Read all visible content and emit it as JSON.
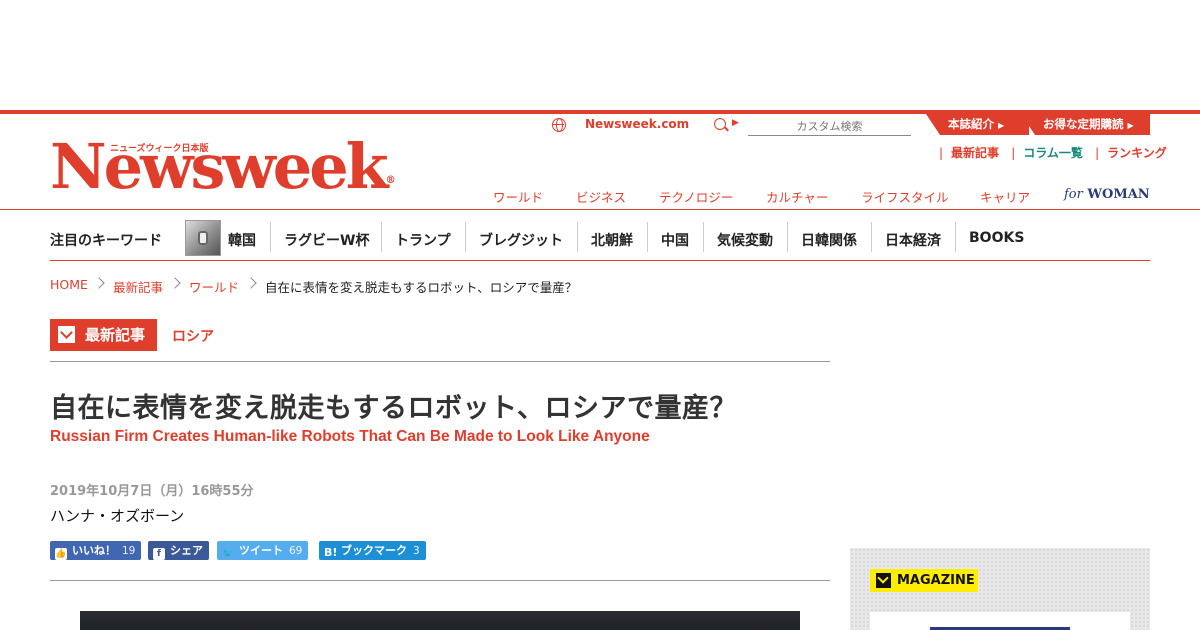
{
  "brand": {
    "logo_sub": "ニューズウィーク日本版",
    "logo": "Newsweek",
    "reg": "®"
  },
  "header": {
    "global_link": "Newsweek.com",
    "search_placeholder": "カスタム検索",
    "red_tabs": [
      "本誌紹介",
      "お得な定期購読"
    ],
    "sub_links": [
      "最新記事",
      "コラム一覧",
      "ランキング"
    ],
    "categories": [
      "ワールド",
      "ビジネス",
      "テクノロジー",
      "カルチャー",
      "ライフスタイル",
      "キャリア"
    ],
    "for_woman": {
      "prefix": "for",
      "label": "WOMAN"
    }
  },
  "keywords": {
    "title": "注目のキーワード",
    "items": [
      "韓国",
      "ラグビーW杯",
      "トランプ",
      "ブレグジット",
      "北朝鮮",
      "中国",
      "気候変動",
      "日韓関係",
      "日本経済",
      "BOOKS"
    ]
  },
  "breadcrumb": [
    "HOME",
    "最新記事",
    "ワールド",
    "自在に表情を変え脱走もするロボット、ロシアで量産？"
  ],
  "article": {
    "category": "最新記事",
    "tag": "ロシア",
    "title_ja": "自在に表情を変え脱走もするロボット、ロシアで量産？",
    "title_en": "Russian Firm Creates Human-like Robots That Can Be Made to Look Like Anyone",
    "date": "2019年10月7日（月）16時55分",
    "author": "ハンナ・オズボーン"
  },
  "share": {
    "like": {
      "label": "いいね！",
      "count": "19"
    },
    "share": {
      "label": "シェア"
    },
    "tweet": {
      "label": "ツイート",
      "count": "69"
    },
    "hatena": {
      "label": "ブックマーク",
      "count": "3"
    }
  },
  "sidebar": {
    "magazine_label": "MAGAZINE"
  },
  "colors": {
    "brand_red": "#e03e2d",
    "magazine_yellow": "#ffed00",
    "woman_navy": "#2a3a7a"
  }
}
